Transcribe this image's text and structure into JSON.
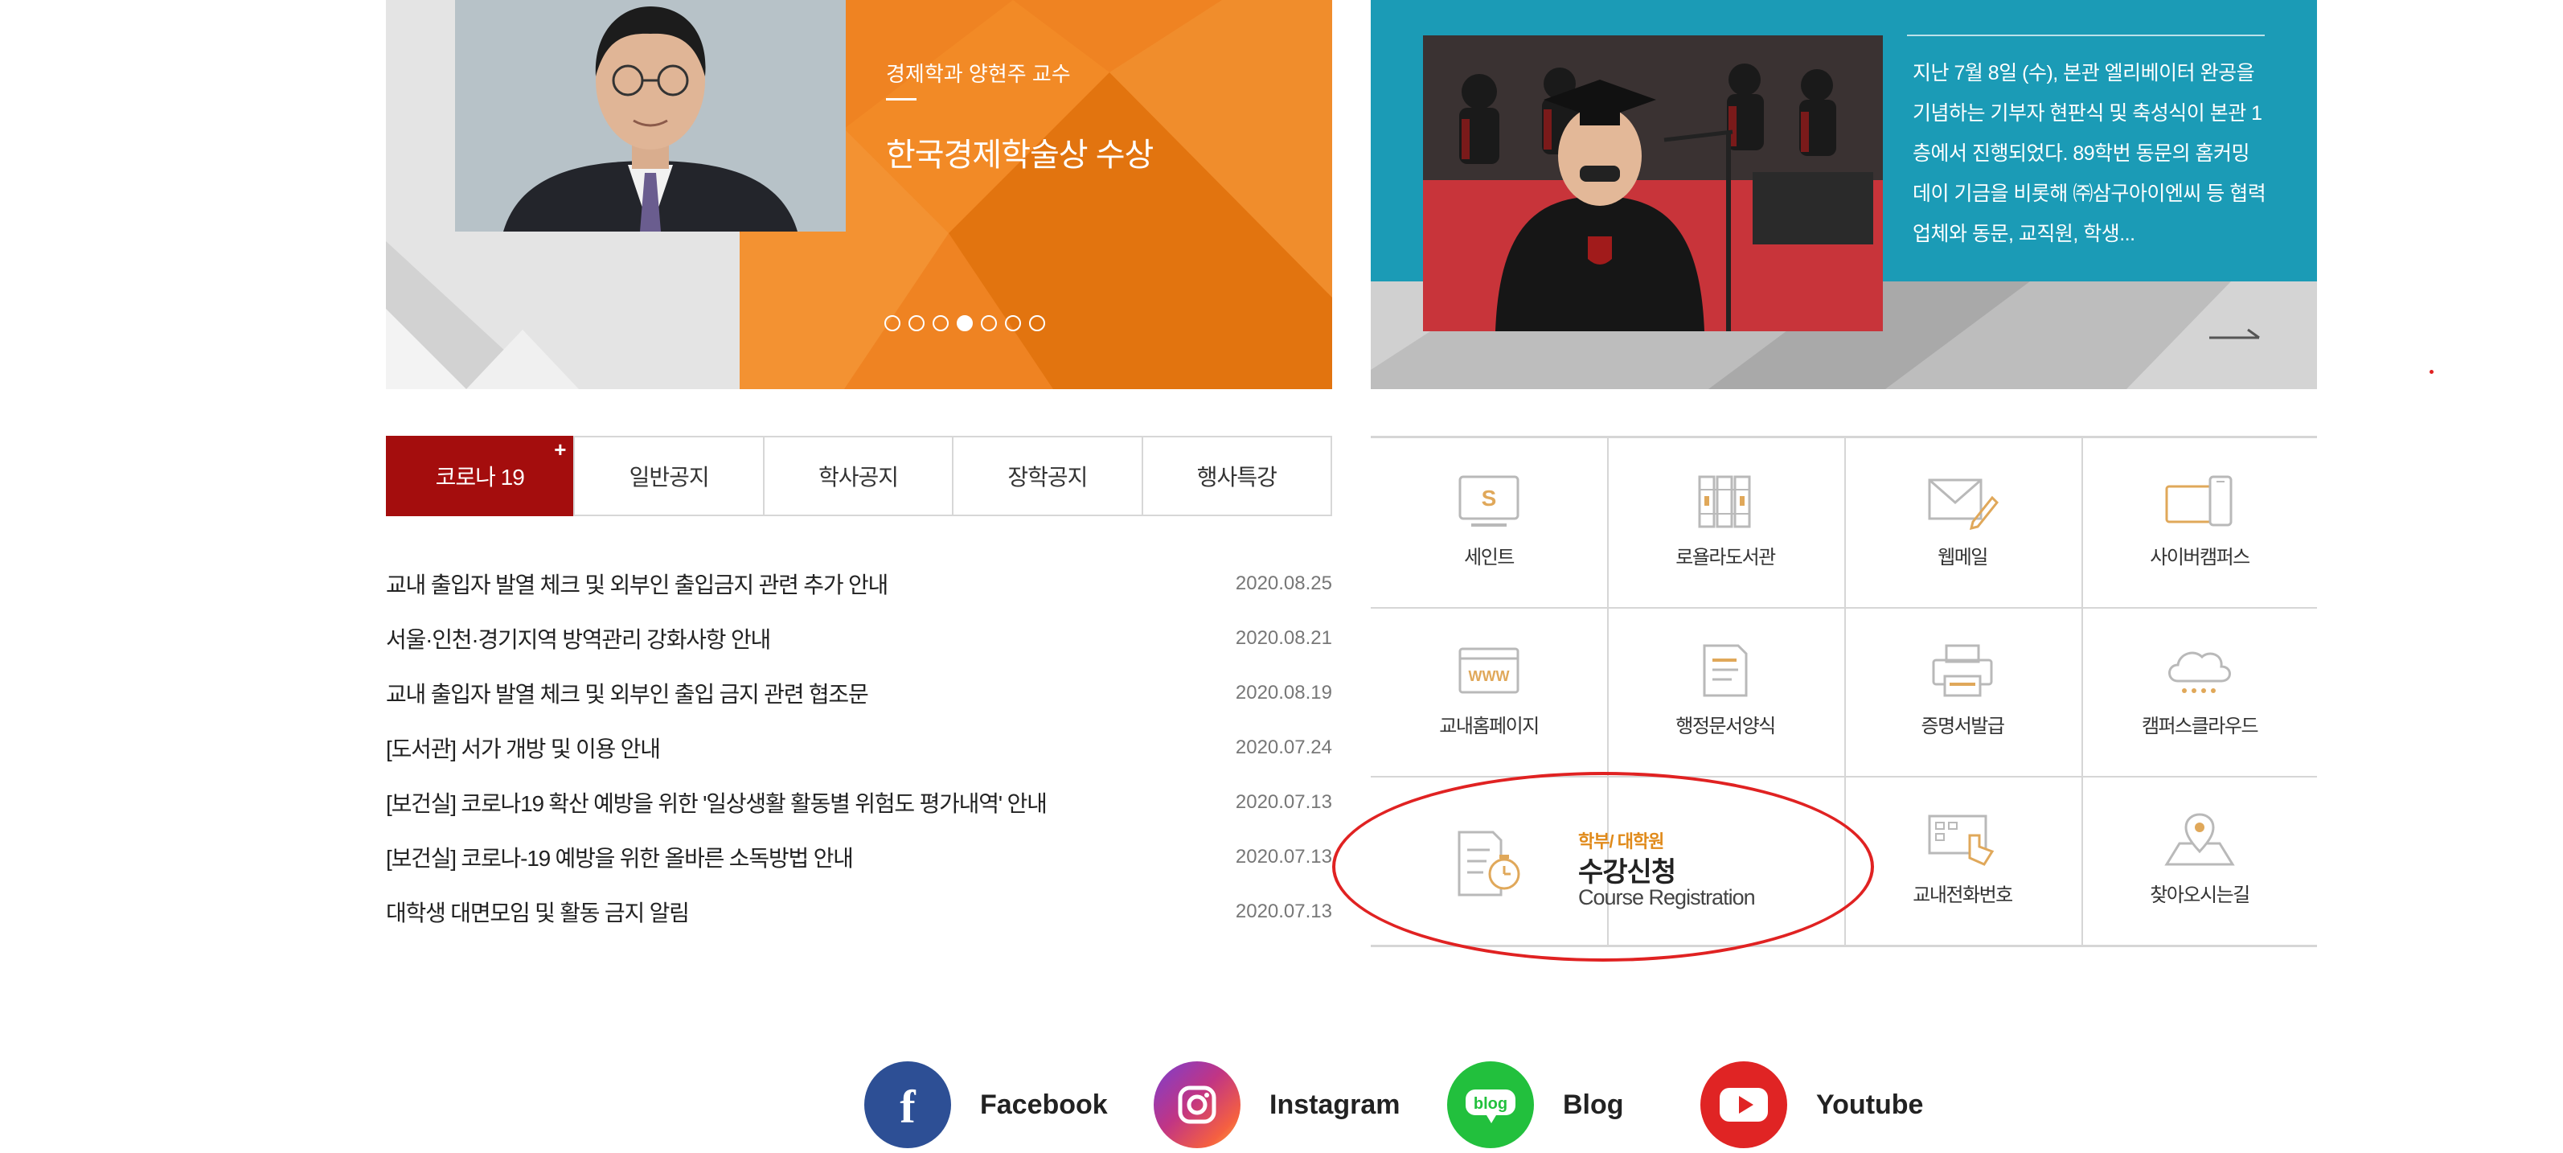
{
  "banner_left": {
    "subtitle": "경제학과 양현주 교수",
    "title": "한국경제학술상 수상",
    "slide_count": 7,
    "active_slide": 4
  },
  "banner_right": {
    "text": "지난 7월 8일 (수), 본관 엘리베이터 완공을 기념하는 기부자 현판식 및 축성식이 본관 1층에서 진행되었다. 89학번 동문의 홈커밍데이 기금을 비롯해 ㈜삼구아이엔씨 등 협력업체와 동문, 교직원, 학생..."
  },
  "tabs": [
    {
      "label": "코로나 19",
      "active": true
    },
    {
      "label": "일반공지"
    },
    {
      "label": "학사공지"
    },
    {
      "label": "장학공지"
    },
    {
      "label": "행사특강"
    }
  ],
  "tab_plus": "+",
  "notices": [
    {
      "title": "교내 출입자 발열 체크 및 외부인 출입금지 관련 추가 안내",
      "date": "2020.08.25"
    },
    {
      "title": "서울·인천·경기지역 방역관리 강화사항 안내",
      "date": "2020.08.21"
    },
    {
      "title": "교내 출입자 발열 체크 및 외부인 출입 금지 관련 협조문",
      "date": "2020.08.19"
    },
    {
      "title": "[도서관] 서가 개방 및 이용 안내",
      "date": "2020.07.24"
    },
    {
      "title": "[보건실] 코로나19 확산 예방을 위한 '일상생활 활동별 위험도 평가내역' 안내",
      "date": "2020.07.13"
    },
    {
      "title": "[보건실] 코로나-19 예방을 위한 올바른 소독방법 안내",
      "date": "2020.07.13"
    },
    {
      "title": "대학생 대면모임 및 활동 금지 알림",
      "date": "2020.07.13"
    }
  ],
  "quick_menu": [
    {
      "label": "세인트",
      "icon": "saint-icon"
    },
    {
      "label": "로욜라도서관",
      "icon": "library-icon"
    },
    {
      "label": "웹메일",
      "icon": "mail-icon"
    },
    {
      "label": "사이버캠퍼스",
      "icon": "devices-icon"
    },
    {
      "label": "교내홈페이지",
      "icon": "www-icon"
    },
    {
      "label": "행정문서양식",
      "icon": "document-icon"
    },
    {
      "label": "증명서발급",
      "icon": "printer-icon"
    },
    {
      "label": "캠퍼스클라우드",
      "icon": "cloud-icon"
    },
    {
      "label": "교내전화번호",
      "icon": "phone-directory-icon"
    },
    {
      "label": "찾아오시는길",
      "icon": "map-pin-icon"
    }
  ],
  "course_registration": {
    "sub": "학부/ 대학원",
    "title": "수강신청",
    "english": "Course Registration"
  },
  "social": [
    {
      "name": "Facebook",
      "color": "#2d4f95"
    },
    {
      "name": "Instagram",
      "color": "#c13584"
    },
    {
      "name": "Blog",
      "color": "#22c03d"
    },
    {
      "name": "Youtube",
      "color": "#e02424"
    }
  ],
  "colors": {
    "accent_red": "#a40d0d",
    "banner_orange": "#f08a24",
    "banner_teal": "#1a9ab5",
    "icon_gold": "#e0a85a",
    "icon_gray": "#b9b9b9"
  }
}
